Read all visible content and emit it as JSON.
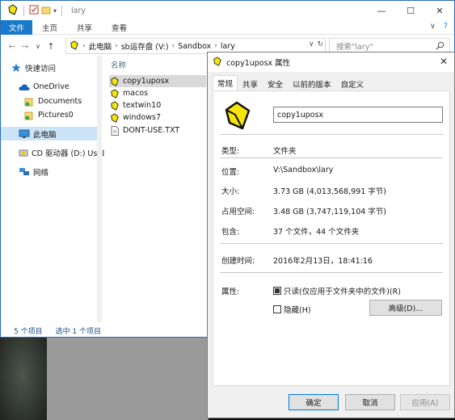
{
  "explorer": {
    "window_title": "lary",
    "ribbon_tabs": [
      "文件",
      "主页",
      "共享",
      "查看"
    ],
    "breadcrumb": [
      "此电脑",
      "sb运存盘 (V:)",
      "Sandbox",
      "lary"
    ],
    "search_placeholder": "搜索\"lary\"",
    "column_header": "名称",
    "nav_items": [
      {
        "label": "快速访问",
        "icon": "star-icon"
      },
      {
        "label": "OneDrive",
        "icon": "cloud-icon"
      },
      {
        "label": "Documents",
        "icon": "folder-synced-icon"
      },
      {
        "label": "Pictures0",
        "icon": "folder-synced-icon"
      },
      {
        "label": "此电脑",
        "icon": "computer-icon"
      },
      {
        "label": "CD 驱动器 (D:) UsbD",
        "icon": "cd-drive-icon"
      },
      {
        "label": "网络",
        "icon": "network-icon"
      }
    ],
    "files": [
      {
        "name": "copy1uposx",
        "icon": "sandboxie-folder-icon",
        "selected": true
      },
      {
        "name": "macos",
        "icon": "sandboxie-folder-icon",
        "selected": false
      },
      {
        "name": "textwin10",
        "icon": "sandboxie-folder-icon",
        "selected": false
      },
      {
        "name": "windows7",
        "icon": "sandboxie-folder-icon",
        "selected": false
      },
      {
        "name": "DONT-USE.TXT",
        "icon": "text-file-icon",
        "selected": false
      }
    ],
    "status": {
      "count": "5 个项目",
      "selected": "选中 1 个项目"
    }
  },
  "dialog": {
    "title": "copy1uposx 属性",
    "tabs": [
      "常规",
      "共享",
      "安全",
      "以前的版本",
      "自定义"
    ],
    "active_tab": "常规",
    "name_value": "copy1uposx",
    "type_label": "类型:",
    "type_value": "文件夹",
    "location_label": "位置:",
    "location_value": "V:\\Sandbox\\lary",
    "size_label": "大小:",
    "size_value": "3.73 GB (4,013,568,991 字节)",
    "disk_label": "占用空间:",
    "disk_value": "3.48 GB (3,747,119,104 字节)",
    "contains_label": "包含:",
    "contains_value": "37 个文件，44 个文件夹",
    "created_label": "创建时间:",
    "created_value": "2016年2月13日，18:41:16",
    "attr_label": "属性:",
    "readonly_label": "只读(仅应用于文件夹中的文件)(R)",
    "hidden_label": "隐藏(H)",
    "advanced_label": "高级(D)...",
    "ok_label": "确定",
    "cancel_label": "取消",
    "apply_label": "应用(A)"
  },
  "colors": {
    "accent": "#1979ca",
    "sandboxie_yellow": "#f5e50a",
    "selection": "#cce4f7"
  }
}
